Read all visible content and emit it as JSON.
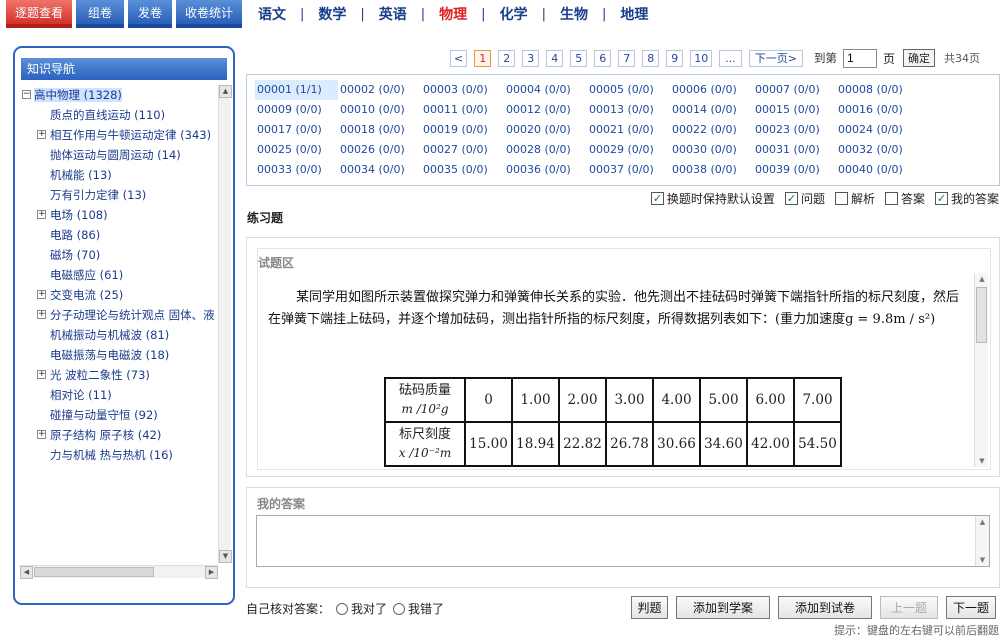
{
  "top_tabs": [
    {
      "label": "逐题查看",
      "active": true
    },
    {
      "label": "组卷",
      "active": false
    },
    {
      "label": "发卷",
      "active": false
    },
    {
      "label": "收卷统计",
      "active": false
    }
  ],
  "subjects": [
    {
      "label": "语文",
      "active": false
    },
    {
      "label": "数学",
      "active": false
    },
    {
      "label": "英语",
      "active": false
    },
    {
      "label": "物理",
      "active": true
    },
    {
      "label": "化学",
      "active": false
    },
    {
      "label": "生物",
      "active": false
    },
    {
      "label": "地理",
      "active": false
    }
  ],
  "subject_separator": "|",
  "nav": {
    "title": "知识导航",
    "items": [
      {
        "label": "高中物理 (1328)",
        "level": 0,
        "toggle": "−",
        "selected": true
      },
      {
        "label": "质点的直线运动 (110)",
        "level": 1,
        "toggle": ""
      },
      {
        "label": "相互作用与牛顿运动定律 (343)",
        "level": 1,
        "toggle": "+"
      },
      {
        "label": "抛体运动与圆周运动 (14)",
        "level": 1,
        "toggle": ""
      },
      {
        "label": "机械能 (13)",
        "level": 1,
        "toggle": ""
      },
      {
        "label": "万有引力定律 (13)",
        "level": 1,
        "toggle": ""
      },
      {
        "label": "电场 (108)",
        "level": 1,
        "toggle": "+"
      },
      {
        "label": "电路 (86)",
        "level": 1,
        "toggle": ""
      },
      {
        "label": "磁场 (70)",
        "level": 1,
        "toggle": ""
      },
      {
        "label": "电磁感应 (61)",
        "level": 1,
        "toggle": ""
      },
      {
        "label": "交变电流 (25)",
        "level": 1,
        "toggle": "+"
      },
      {
        "label": "分子动理论与统计观点  固体、液",
        "level": 1,
        "toggle": "+"
      },
      {
        "label": "机械振动与机械波 (81)",
        "level": 1,
        "toggle": ""
      },
      {
        "label": "电磁振荡与电磁波 (18)",
        "level": 1,
        "toggle": ""
      },
      {
        "label": "光  波粒二象性 (73)",
        "level": 1,
        "toggle": "+"
      },
      {
        "label": "相对论 (11)",
        "level": 1,
        "toggle": ""
      },
      {
        "label": "碰撞与动量守恒 (92)",
        "level": 1,
        "toggle": ""
      },
      {
        "label": "原子结构  原子核 (42)",
        "level": 1,
        "toggle": "+"
      },
      {
        "label": "力与机械  热与热机 (16)",
        "level": 1,
        "toggle": ""
      }
    ]
  },
  "pager": {
    "prev": "<",
    "pages": [
      "1",
      "2",
      "3",
      "4",
      "5",
      "6",
      "7",
      "8",
      "9",
      "10",
      "..."
    ],
    "current": "1",
    "next": "下一页>",
    "goto_label": "到第",
    "goto_value": "1",
    "page_unit": "页",
    "confirm": "确定",
    "total": "共34页"
  },
  "questions": [
    "00001 (1/1)",
    "00002 (0/0)",
    "00003 (0/0)",
    "00004 (0/0)",
    "00005 (0/0)",
    "00006 (0/0)",
    "00007 (0/0)",
    "00008 (0/0)",
    "00009 (0/0)",
    "00010 (0/0)",
    "00011 (0/0)",
    "00012 (0/0)",
    "00013 (0/0)",
    "00014 (0/0)",
    "00015 (0/0)",
    "00016 (0/0)",
    "00017 (0/0)",
    "00018 (0/0)",
    "00019 (0/0)",
    "00020 (0/0)",
    "00021 (0/0)",
    "00022 (0/0)",
    "00023 (0/0)",
    "00024 (0/0)",
    "00025 (0/0)",
    "00026 (0/0)",
    "00027 (0/0)",
    "00028 (0/0)",
    "00029 (0/0)",
    "00030 (0/0)",
    "00031 (0/0)",
    "00032 (0/0)",
    "00033 (0/0)",
    "00034 (0/0)",
    "00035 (0/0)",
    "00036 (0/0)",
    "00037 (0/0)",
    "00038 (0/0)",
    "00039 (0/0)",
    "00040 (0/0)"
  ],
  "active_question": "00001 (1/1)",
  "options": [
    {
      "label": "换题时保持默认设置",
      "checked": true
    },
    {
      "label": "问题",
      "checked": true
    },
    {
      "label": "解析",
      "checked": false
    },
    {
      "label": "答案",
      "checked": false
    },
    {
      "label": "我的答案",
      "checked": true
    }
  ],
  "check_mark": "✓",
  "section_title": "练习题",
  "question_area": {
    "label": "试题区",
    "text": "某同学用如图所示装置做探究弹力和弹簧伸长关系的实验．他先测出不挂砝码时弹簧下端指针所指的标尺刻度，然后在弹簧下端挂上砝码，并逐个增加砝码，测出指针所指的标尺刻度，所得数据列表如下：(重力加速度g = 9.8m / s²)",
    "table": {
      "row1_header": "砝码质量",
      "row1_unit": "m /10²g",
      "row1_values": [
        "0",
        "1.00",
        "2.00",
        "3.00",
        "4.00",
        "5.00",
        "6.00",
        "7.00"
      ],
      "row2_header": "标尺刻度",
      "row2_unit": "x /10⁻²m",
      "row2_values": [
        "15.00",
        "18.94",
        "22.82",
        "26.78",
        "30.66",
        "34.60",
        "42.00",
        "54.50"
      ]
    }
  },
  "answer": {
    "label": "我的答案",
    "value": ""
  },
  "self_check": {
    "label": "自己核对答案：",
    "right": "我对了",
    "wrong": "我错了"
  },
  "buttons": [
    {
      "label": "判题",
      "disabled": false
    },
    {
      "label": "添加到学案",
      "disabled": false
    },
    {
      "label": "添加到试卷",
      "disabled": false
    },
    {
      "label": "上一题",
      "disabled": true
    },
    {
      "label": "下一题",
      "disabled": false
    }
  ],
  "hint": "提示：键盘的左右键可以前后翻题",
  "icons": {
    "arrow_up": "▲",
    "arrow_down": "▼",
    "arrow_left": "◀",
    "arrow_right": "▶"
  }
}
